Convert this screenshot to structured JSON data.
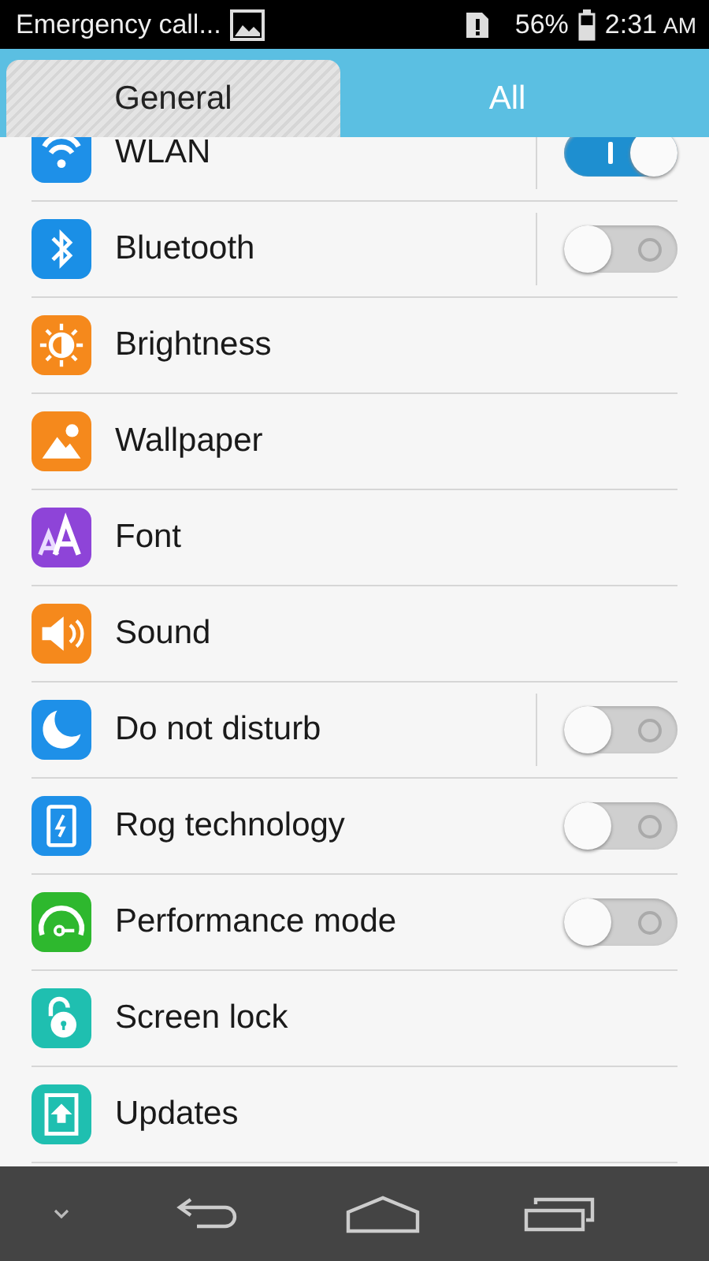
{
  "status_bar": {
    "carrier": "Emergency call...",
    "battery": "56%",
    "time": "2:31",
    "ampm": "AM"
  },
  "tabs": [
    {
      "label": "General",
      "selected": true
    },
    {
      "label": "All",
      "selected": false
    }
  ],
  "settings": [
    {
      "label": "WLAN",
      "kind": "split-switch",
      "on": true
    },
    {
      "label": "Bluetooth",
      "kind": "split-switch",
      "on": false
    },
    {
      "label": "Brightness",
      "kind": "link"
    },
    {
      "label": "Wallpaper",
      "kind": "link"
    },
    {
      "label": "Font",
      "kind": "link"
    },
    {
      "label": "Sound",
      "kind": "link"
    },
    {
      "label": "Do not disturb",
      "kind": "split-switch",
      "on": false
    },
    {
      "label": "Rog technology",
      "kind": "switch",
      "on": false
    },
    {
      "label": "Performance mode",
      "kind": "switch",
      "on": false
    },
    {
      "label": "Screen lock",
      "kind": "link"
    },
    {
      "label": "Updates",
      "kind": "link"
    }
  ]
}
